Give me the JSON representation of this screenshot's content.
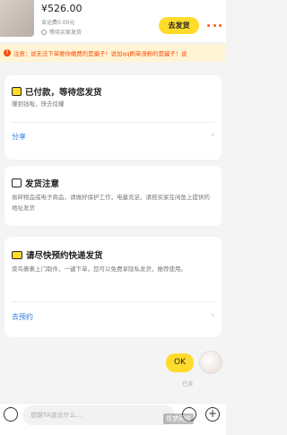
{
  "header": {
    "price": "¥526.00",
    "subline": "含运费0.00元",
    "status": "等待买家发货",
    "ship_button": "去发货"
  },
  "notice": {
    "text": "注意：说无法下单要你缴费的是骗子！说加qq刷单涨粉的是骗子！说"
  },
  "cards": [
    {
      "title": "已付款，等待您发货",
      "desc": "赚到钱啦，快去炫耀",
      "link": "分享",
      "icon": "payment-icon"
    },
    {
      "title": "发货注意",
      "desc": "易碎物品或电子商品，请做好保护工作，电量充足。请按买家在闲鱼上提供的地址发货",
      "icon": "clipboard-icon"
    },
    {
      "title": "请尽快预约快递发货",
      "desc": "菜鸟裹裹上门取件，一键下单，您可以免费享隐私发货，推荐使用。",
      "link": "去预约",
      "icon": "truck-icon"
    }
  ],
  "chat": {
    "ok_message": "OK",
    "read_status": "已读"
  },
  "input": {
    "placeholder": "想跟TA说点什么..."
  },
  "watermark": "悟梦网技"
}
